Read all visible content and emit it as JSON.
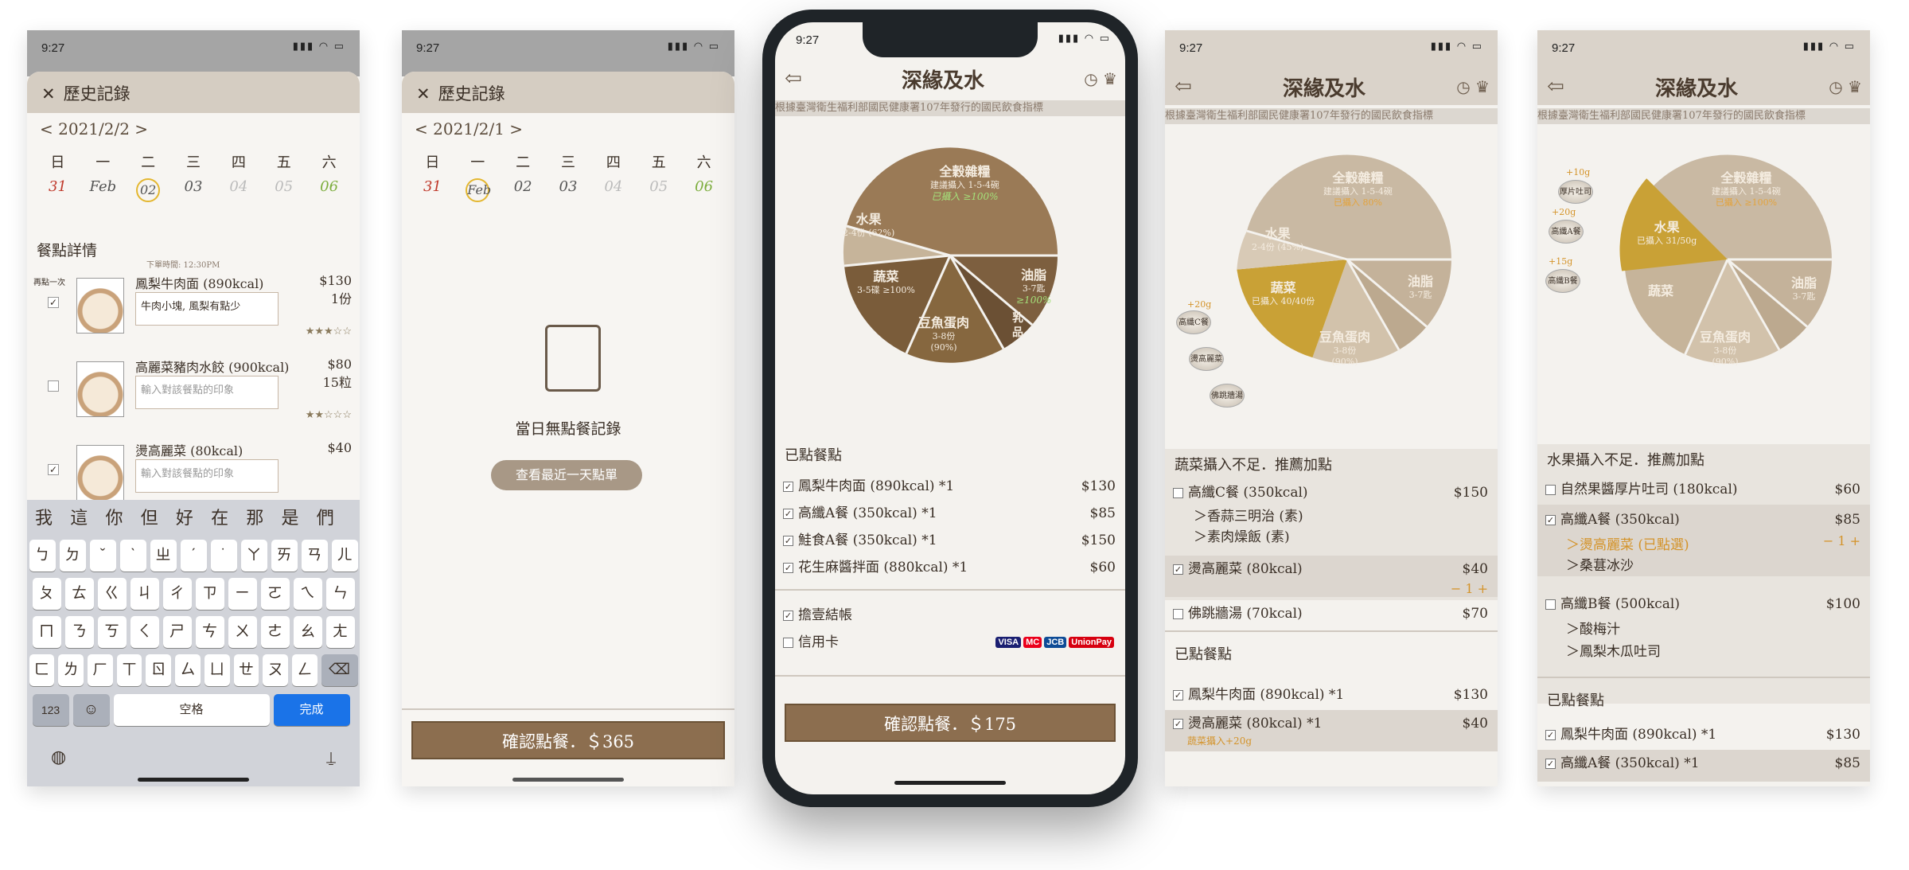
{
  "screen1": {
    "time": "9:27",
    "header": "歷史記錄",
    "date_nav": "< 2021/2/2 >",
    "weekdays": [
      "日",
      "一",
      "二",
      "三",
      "四",
      "五",
      "六"
    ],
    "days": [
      "31",
      "Feb",
      "02",
      "03",
      "04",
      "05",
      "06"
    ],
    "section": "餐點詳情",
    "order_time": "下單時間: 12:30PM",
    "again": "再點一次",
    "items": [
      {
        "name": "鳳梨牛肉面 (890kcal)",
        "price": "$130",
        "qty": "1份",
        "note": "牛肉小塊, 風梨有點少",
        "stars": "★★★☆☆"
      },
      {
        "name": "高麗菜豬肉水餃 (900kcal)",
        "price": "$80",
        "qty": "15粒",
        "note": "輸入對該餐點的印象",
        "stars": "★★☆☆☆"
      },
      {
        "name": "燙高麗菜 (80kcal)",
        "price": "$40",
        "qty": "",
        "note": "輸入對該餐點的印象",
        "stars": ""
      }
    ],
    "candidates": [
      "我",
      "這",
      "你",
      "但",
      "好",
      "在",
      "那",
      "是",
      "們"
    ],
    "row1": [
      "ㄅ",
      "ㄉ",
      "ˇ",
      "ˋ",
      "ㄓ",
      "ˊ",
      "˙",
      "ㄚ",
      "ㄞ",
      "ㄢ",
      "ㄦ"
    ],
    "row2": [
      "ㄆ",
      "ㄊ",
      "ㄍ",
      "ㄐ",
      "ㄔ",
      "ㄗ",
      "ㄧ",
      "ㄛ",
      "ㄟ",
      "ㄣ"
    ],
    "row3": [
      "ㄇ",
      "ㄋ",
      "ㄎ",
      "ㄑ",
      "ㄕ",
      "ㄘ",
      "ㄨ",
      "ㄜ",
      "ㄠ",
      "ㄤ"
    ],
    "row4": [
      "ㄈ",
      "ㄌ",
      "ㄏ",
      "ㄒ",
      "ㄖ",
      "ㄙ",
      "ㄩ",
      "ㄝ",
      "ㄡ",
      "ㄥ"
    ],
    "k123": "123",
    "space": "空格",
    "done": "完成"
  },
  "screen2": {
    "time": "9:27",
    "header": "歷史記錄",
    "date_nav": "< 2021/2/1 >",
    "weekdays": [
      "日",
      "一",
      "二",
      "三",
      "四",
      "五",
      "六"
    ],
    "days": [
      "31",
      "Feb",
      "02",
      "03",
      "04",
      "05",
      "06"
    ],
    "empty": "當日無點餐記錄",
    "recent": "查看最近一天點單",
    "confirm": "確認點餐．＄365"
  },
  "brand": "深緣及水",
  "ticker": "根據臺灣衛生福利部國民健康署107年發行的國民飲食指標",
  "pie": {
    "grain": "全穀雜糧",
    "grain_sub": "建議攝入 1-5-4碗",
    "grain_s3": "已攝入 ≥100%",
    "grain_s4": "已攝入 80%",
    "fruit": "水果",
    "fruit_s3": "2-4份 (62%)",
    "fruit_s4": "2-4份 (45%)",
    "veg": "蔬菜",
    "veg_s3": "3-5碟 ≥100%",
    "oil": "油脂",
    "oil_s": "3-7匙",
    "oil_p": "≥100%",
    "dairy": "乳品",
    "meat": "豆魚蛋肉",
    "meat_s": "3-8份",
    "meat_p": "(90%)"
  },
  "screen3": {
    "time": "9:27",
    "ordered": "已點餐點",
    "items": [
      {
        "n": "鳳梨牛肉面 (890kcal) *1",
        "p": "$130"
      },
      {
        "n": "高纖A餐 (350kcal) *1",
        "p": "$85"
      },
      {
        "n": "鮭食A餐 (350kcal) *1",
        "p": "$150"
      },
      {
        "n": "花生麻醬拌面 (880kcal) *1",
        "p": "$60"
      }
    ],
    "pay1": "擔壹結帳",
    "pay2": "信用卡",
    "cards": [
      "VISA",
      "MC",
      "JCB",
      "UnionPay"
    ],
    "confirm": "確認點餐．＄175"
  },
  "screen4": {
    "time": "9:27",
    "veg_taken": "已攝入 40/40份",
    "advice": "蔬菜攝入不足．推薦加點",
    "recs": [
      {
        "n": "高纖C餐 (350kcal)",
        "p": "$150",
        "subs": [
          "＞香蒜三明治 (素)",
          "＞素肉燥飯 (素)"
        ]
      },
      {
        "n": "燙高麗菜 (80kcal)",
        "p": "$40",
        "qty": "− 1 +"
      },
      {
        "n": "佛跳牆湯 (70kcal)",
        "p": "$70"
      }
    ],
    "ordered": "已點餐點",
    "items": [
      {
        "n": "鳳梨牛肉面 (890kcal) *1",
        "p": "$130"
      },
      {
        "n": "燙高麗菜 (80kcal) *1",
        "p": "$40"
      }
    ],
    "note": "蔬菜攝入+20g",
    "chips": [
      "高纖C餐",
      "燙高麗菜",
      "佛跳牆湯"
    ],
    "chip_add": "+20g"
  },
  "screen5": {
    "time": "9:27",
    "fruit_taken": "已攝入 31/50g",
    "advice": "水果攝入不足．推薦加點",
    "recs": [
      {
        "n": "自然果醬厚片吐司 (180kcal)",
        "p": "$60"
      },
      {
        "n": "高纖A餐 (350kcal)",
        "p": "$85",
        "subs": [
          "＞燙高麗菜 (已點選)",
          "＞桑葚冰沙"
        ],
        "qty": "− 1 +"
      },
      {
        "n": "高纖B餐 (500kcal)",
        "p": "$100",
        "subs": [
          "＞酸梅汁",
          "＞鳳梨木瓜吐司"
        ]
      }
    ],
    "ordered": "已點餐點",
    "items": [
      {
        "n": "鳳梨牛肉面 (890kcal) *1",
        "p": "$130"
      },
      {
        "n": "高纖A餐 (350kcal) *1",
        "p": "$85"
      }
    ],
    "chips": [
      "厚片吐司",
      "高纖A餐",
      "高纖B餐"
    ],
    "chip_adds": [
      "+10g",
      "+20g",
      "+15g"
    ]
  }
}
